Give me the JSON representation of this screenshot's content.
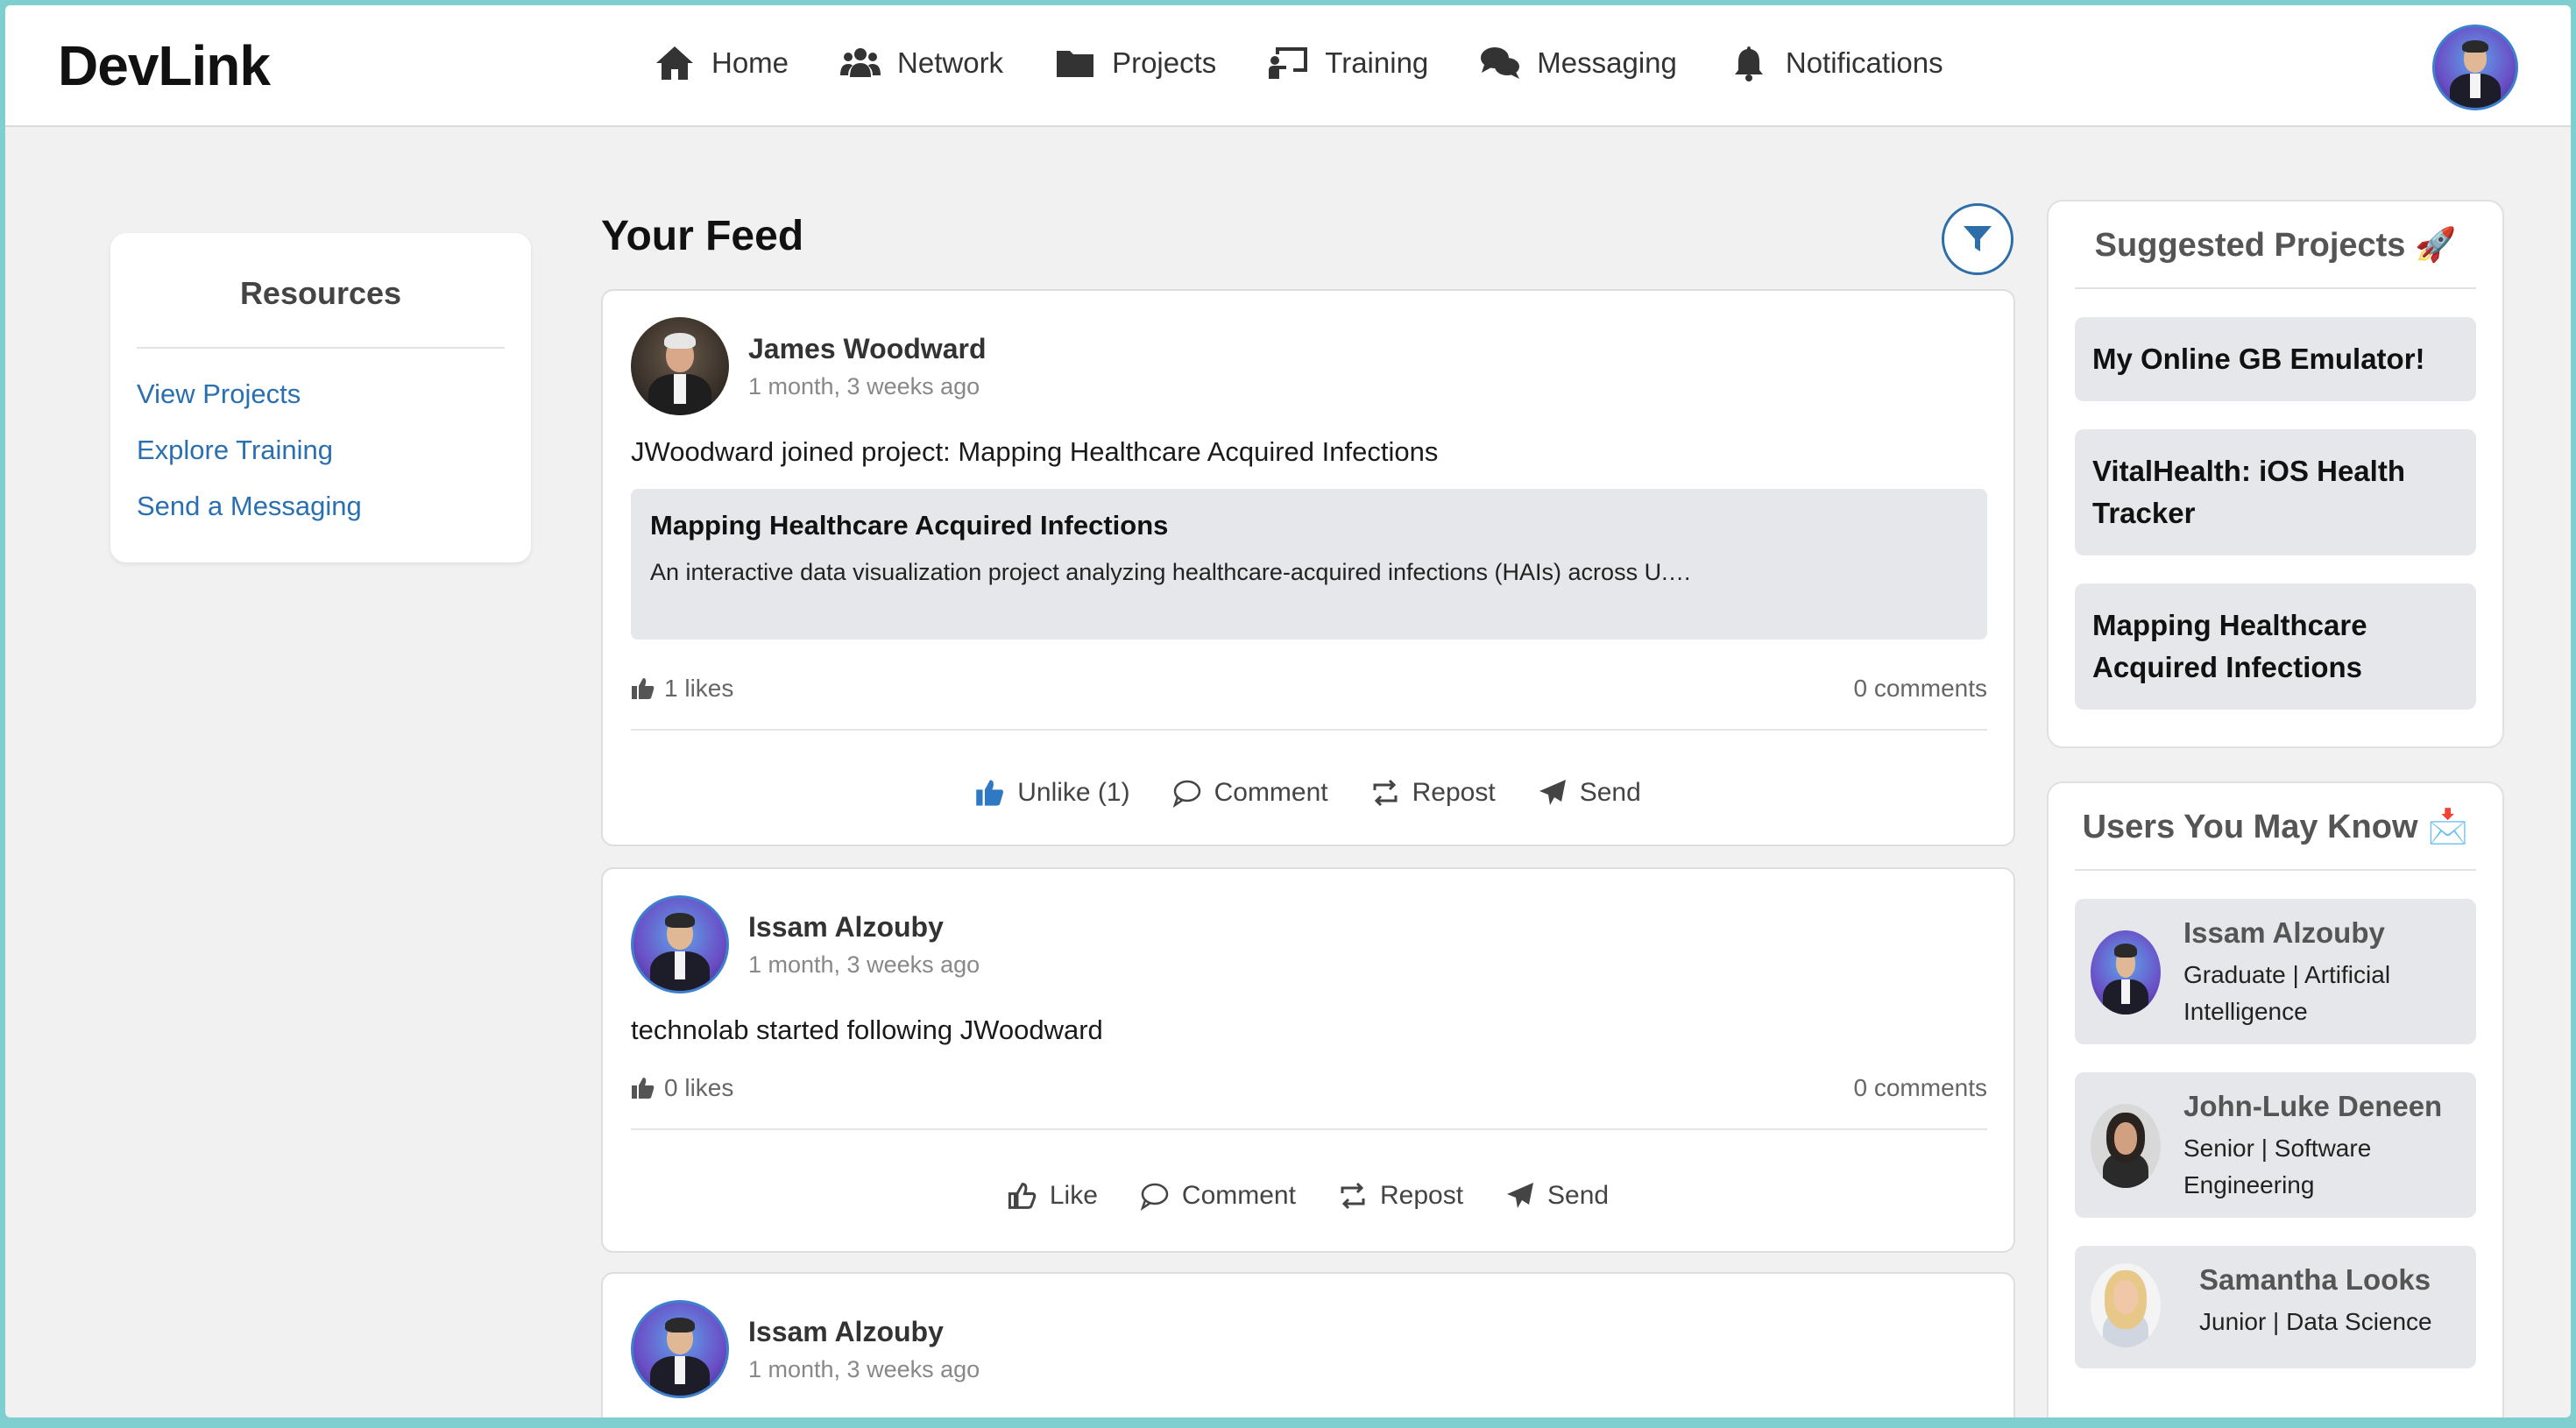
{
  "brand": "DevLink",
  "nav": {
    "items": [
      {
        "label": "Home",
        "icon": "home-icon"
      },
      {
        "label": "Network",
        "icon": "users-icon"
      },
      {
        "label": "Projects",
        "icon": "folder-icon"
      },
      {
        "label": "Training",
        "icon": "training-icon"
      },
      {
        "label": "Messaging",
        "icon": "chat-icon"
      },
      {
        "label": "Notifications",
        "icon": "bell-icon"
      }
    ]
  },
  "resources": {
    "title": "Resources",
    "links": [
      "View Projects",
      "Explore Training",
      "Send a Messaging"
    ]
  },
  "feed": {
    "title": "Your Feed",
    "posts": [
      {
        "author": "James Woodward",
        "time": "1 month, 3 weeks ago",
        "text": "JWoodward joined project: Mapping Healthcare Acquired Infections",
        "project_title": "Mapping Healthcare Acquired Infections",
        "project_desc": "An interactive data visualization project analyzing healthcare-acquired infections (HAIs) across U.…",
        "likes": "1 likes",
        "comments": "0 comments",
        "actions": {
          "like": "Unlike (1)",
          "comment": "Comment",
          "repost": "Repost",
          "send": "Send"
        }
      },
      {
        "author": "Issam Alzouby",
        "time": "1 month, 3 weeks ago",
        "text": "technolab started following JWoodward",
        "likes": "0 likes",
        "comments": "0 comments",
        "actions": {
          "like": "Like",
          "comment": "Comment",
          "repost": "Repost",
          "send": "Send"
        }
      },
      {
        "author": "Issam Alzouby",
        "time": "1 month, 3 weeks ago"
      }
    ]
  },
  "suggested_projects": {
    "title": "Suggested Projects 🚀",
    "items": [
      "My Online GB Emulator!",
      "VitalHealth: iOS Health Tracker",
      "Mapping Healthcare Acquired Infections"
    ]
  },
  "users_you_may_know": {
    "title": "Users You May Know 📩",
    "users": [
      {
        "name": "Issam Alzouby",
        "role": "Graduate | Artificial Intelligence"
      },
      {
        "name": "John-Luke Deneen",
        "role": "Senior | Software Engineering"
      },
      {
        "name": "Samantha Looks",
        "role": "Junior | Data Science"
      }
    ]
  },
  "colors": {
    "accent": "#2d6ea8",
    "link": "#2a6fb0",
    "liked": "#2f78c4",
    "background": "#f1f1f1",
    "window_border": "#7fcfd0"
  }
}
